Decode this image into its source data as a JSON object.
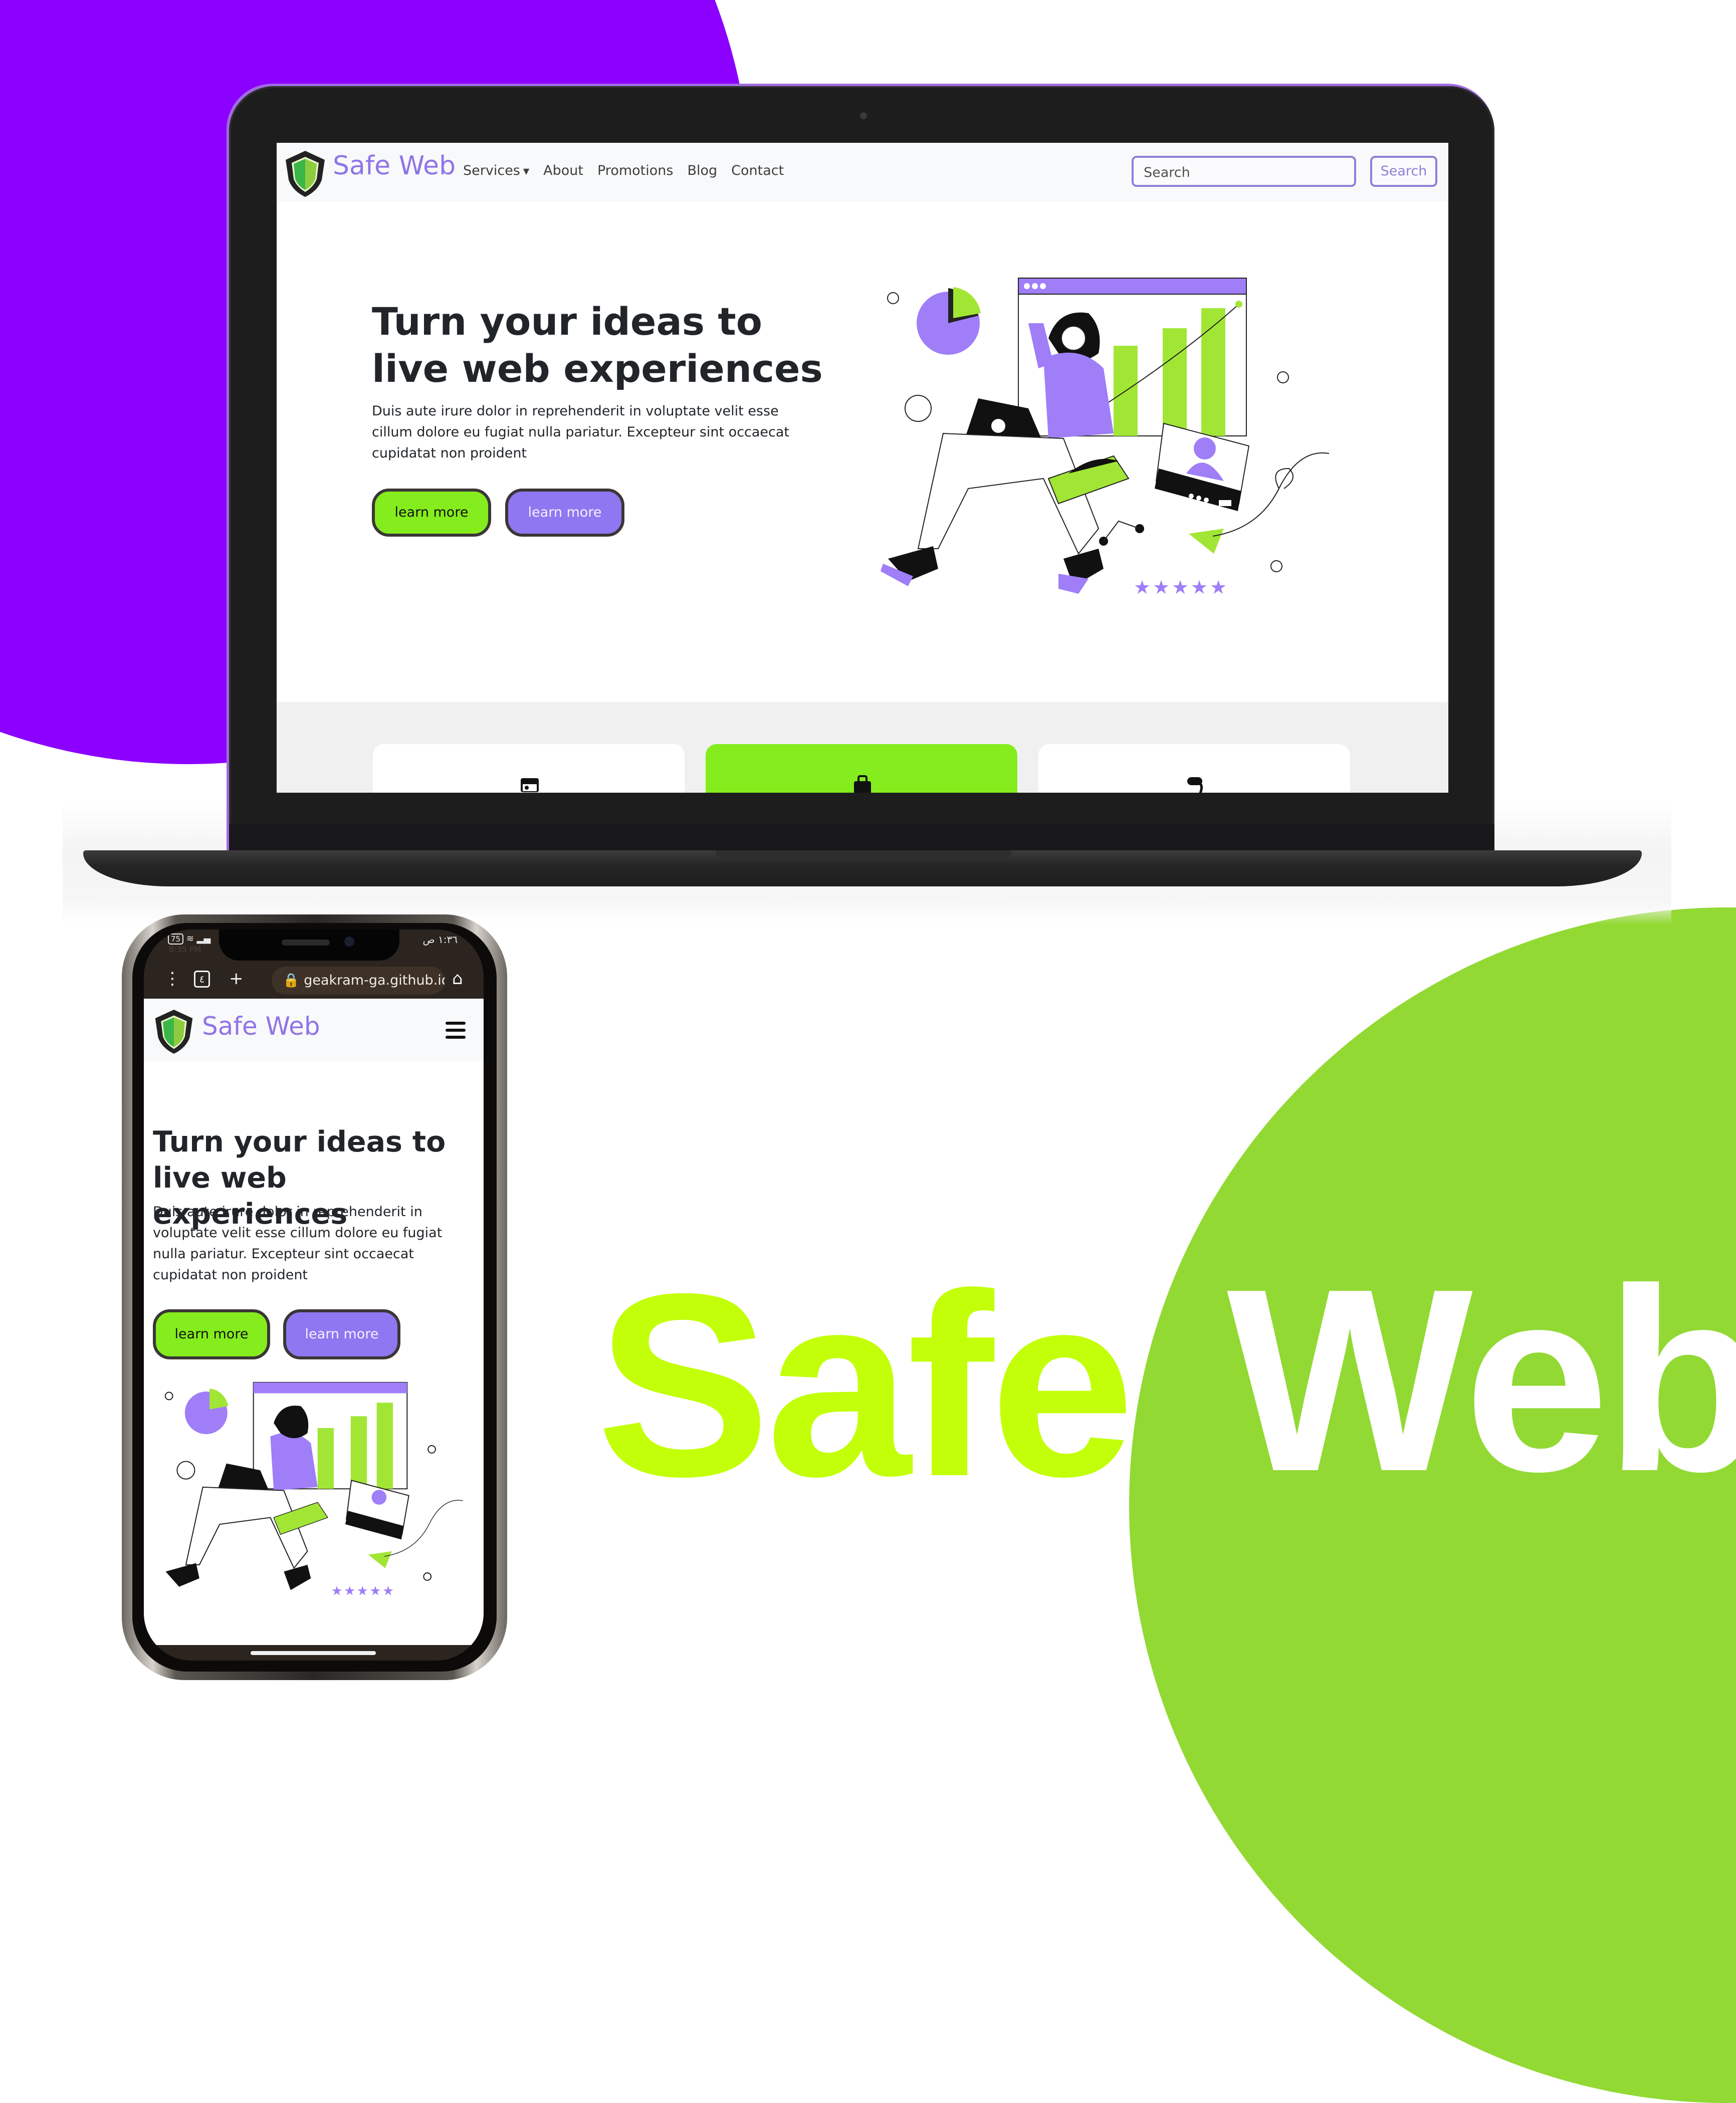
{
  "colors": {
    "background_purple": "#8c00ff",
    "background_green": "#92d934",
    "brand_purple": "#8f74e8",
    "button_green": "#85ed1d",
    "button_purple": "#8e77f0",
    "headline_safe": "#c3ff08",
    "headline_web": "#ffffff"
  },
  "laptop_site": {
    "brand": "Safe Web",
    "nav": [
      {
        "label": "Services",
        "icon": "caret-down-icon"
      },
      {
        "label": "About"
      },
      {
        "label": "Promotions"
      },
      {
        "label": "Blog"
      },
      {
        "label": "Contact"
      }
    ],
    "search": {
      "placeholder": "Search",
      "button_label": "Search"
    },
    "hero": {
      "title": "Turn your ideas to live web experiences",
      "text": "Duis aute irure dolor in reprehenderit in voluptate velit esse cillum dolore eu fugiat nulla pariatur. Excepteur sint occaecat cupidatat non proident",
      "buttons": [
        "learn more",
        "learn more"
      ]
    },
    "service_cards": [
      {
        "icon": "id-card-icon",
        "active": false
      },
      {
        "icon": "briefcase-icon",
        "active": true
      },
      {
        "icon": "chat-icon",
        "active": false
      }
    ],
    "illustration": {
      "rating_stars": 5
    }
  },
  "phone": {
    "status": {
      "battery": "75",
      "time_left": "8:35 PM",
      "time_right": "١:٣٦ ص"
    },
    "browser": {
      "url": "geakram-ga.github.io",
      "tab_count": "٤"
    },
    "site": {
      "brand": "Safe Web",
      "hero_title": "Turn your ideas to live web experiences",
      "hero_text": "Duis aute irure dolor in reprehenderit in voluptate velit esse cillum dolore eu fugiat nulla pariatur. Excepteur sint occaecat cupidatat non proident",
      "buttons": [
        "learn more",
        "learn more"
      ]
    }
  },
  "headline": {
    "word1": "Safe",
    "word2": "Web"
  }
}
